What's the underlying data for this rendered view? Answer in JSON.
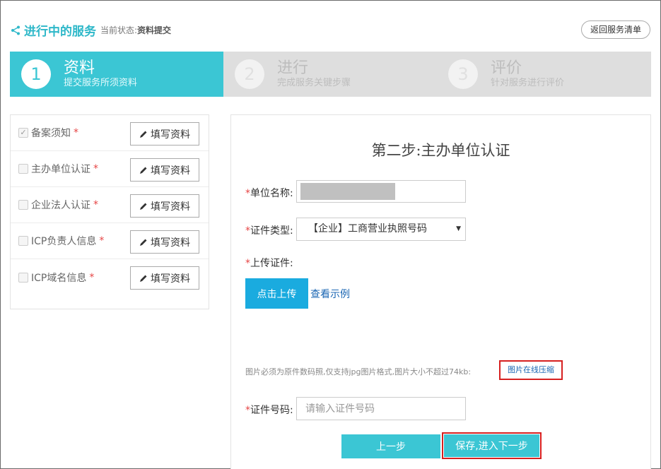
{
  "header": {
    "title": "进行中的服务",
    "status_label": "当前状态:",
    "status_value": "资料提交",
    "back_button": "返回服务清单"
  },
  "steps": [
    {
      "num": "1",
      "title": "资料",
      "subtitle": "提交服务所须资料",
      "active": true
    },
    {
      "num": "2",
      "title": "进行",
      "subtitle": "完成服务关键步骤",
      "active": false
    },
    {
      "num": "3",
      "title": "评价",
      "subtitle": "针对服务进行评价",
      "active": false
    }
  ],
  "left_panel": {
    "fill_button_label": "填写资料",
    "items": [
      {
        "label": "备案须知",
        "checked": true,
        "required": "*"
      },
      {
        "label": "主办单位认证",
        "checked": false,
        "required": "*"
      },
      {
        "label": "企业法人认证",
        "checked": false,
        "required": "*"
      },
      {
        "label": "ICP负责人信息",
        "checked": false,
        "required": "*"
      },
      {
        "label": "ICP域名信息",
        "checked": false,
        "required": "*"
      }
    ]
  },
  "form": {
    "title": "第二步:主办单位认证",
    "unit_name_label": "单位名称:",
    "cert_type_label": "证件类型:",
    "cert_type_value": "【企业】工商营业执照号码",
    "upload_label": "上传证件:",
    "upload_button": "点击上传",
    "example_link": "查看示例",
    "hint": "图片必须为原件数码照,仅支持jpg图片格式,图片大小不超过74kb:",
    "compress_link": "图片在线压缩",
    "cert_number_label": "证件号码:",
    "cert_number_placeholder": "请输入证件号码",
    "required_mark": "*",
    "prev_button": "上一步",
    "next_button": "保存,进入下一步"
  },
  "colors": {
    "accent": "#3bc6d4",
    "upload": "#1aabdf",
    "required": "#e64545",
    "highlight_border": "#d62020"
  }
}
